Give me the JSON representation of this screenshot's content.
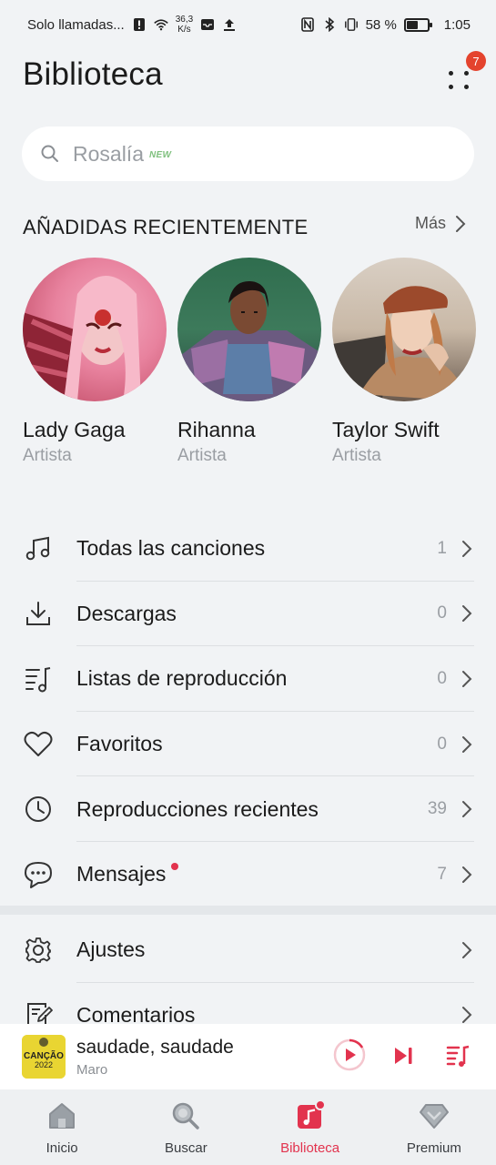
{
  "status_bar": {
    "carrier": "Solo llamadas...",
    "speed_value": "36,3",
    "speed_unit": "K/s",
    "battery": "58 %",
    "time": "1:05"
  },
  "header": {
    "title": "Biblioteca",
    "notification_count": "7"
  },
  "search": {
    "placeholder": "Rosalía",
    "tag": "NEW"
  },
  "recent": {
    "title": "AÑADIDAS RECIENTEMENTE",
    "more_label": "Más",
    "artists": [
      {
        "name": "Lady Gaga",
        "type": "Artista"
      },
      {
        "name": "Rihanna",
        "type": "Artista"
      },
      {
        "name": "Taylor Swift",
        "type": "Artista"
      }
    ]
  },
  "library": {
    "items": [
      {
        "label": "Todas las canciones",
        "count": "1",
        "icon": "music-note-icon"
      },
      {
        "label": "Descargas",
        "count": "0",
        "icon": "download-icon"
      },
      {
        "label": "Listas de reproducción",
        "count": "0",
        "icon": "playlist-icon"
      },
      {
        "label": "Favoritos",
        "count": "0",
        "icon": "heart-icon"
      },
      {
        "label": "Reproducciones recientes",
        "count": "39",
        "icon": "clock-icon"
      },
      {
        "label": "Mensajes",
        "count": "7",
        "icon": "chat-bubble-icon"
      }
    ]
  },
  "settings": {
    "items": [
      {
        "label": "Ajustes",
        "icon": "gear-icon"
      },
      {
        "label": "Comentarios",
        "icon": "feedback-icon"
      }
    ]
  },
  "player": {
    "title": "saudade, saudade",
    "artist": "Maro",
    "art_text_1": "CANÇÃO",
    "art_text_2": "2022"
  },
  "nav": {
    "items": [
      {
        "label": "Inicio",
        "icon": "home-icon"
      },
      {
        "label": "Buscar",
        "icon": "search-icon"
      },
      {
        "label": "Biblioteca",
        "icon": "library-icon"
      },
      {
        "label": "Premium",
        "icon": "diamond-icon"
      }
    ]
  },
  "colors": {
    "accent": "#e2334e",
    "badge": "#e4432d",
    "background": "#f1f3f5"
  }
}
